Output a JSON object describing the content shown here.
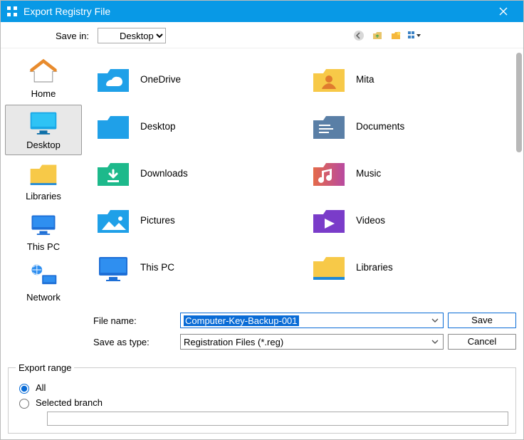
{
  "title": "Export Registry File",
  "toolbar": {
    "save_in_label": "Save in:",
    "save_in_value": "Desktop"
  },
  "sidebar": {
    "places": [
      {
        "label": "Home",
        "icon": "home"
      },
      {
        "label": "Desktop",
        "icon": "desktop",
        "selected": true
      },
      {
        "label": "Libraries",
        "icon": "libraries"
      },
      {
        "label": "This PC",
        "icon": "thispc"
      },
      {
        "label": "Network",
        "icon": "network"
      }
    ]
  },
  "files": [
    {
      "label": "OneDrive",
      "icon": "onedrive"
    },
    {
      "label": "Mita",
      "icon": "user"
    },
    {
      "label": "Desktop",
      "icon": "desktop-folder"
    },
    {
      "label": "Documents",
      "icon": "documents"
    },
    {
      "label": "Downloads",
      "icon": "downloads"
    },
    {
      "label": "Music",
      "icon": "music"
    },
    {
      "label": "Pictures",
      "icon": "pictures"
    },
    {
      "label": "Videos",
      "icon": "videos"
    },
    {
      "label": "This PC",
      "icon": "thispc-big"
    },
    {
      "label": "Libraries",
      "icon": "libraries-big"
    }
  ],
  "form": {
    "file_name_label": "File name:",
    "file_name_value": "Computer-Key-Backup-001",
    "type_label": "Save as type:",
    "type_value": "Registration Files (*.reg)",
    "save_btn": "Save",
    "cancel_btn": "Cancel"
  },
  "export": {
    "legend": "Export range",
    "all_label": "All",
    "selected_label": "Selected branch",
    "selected_value": "",
    "choice": "all"
  }
}
